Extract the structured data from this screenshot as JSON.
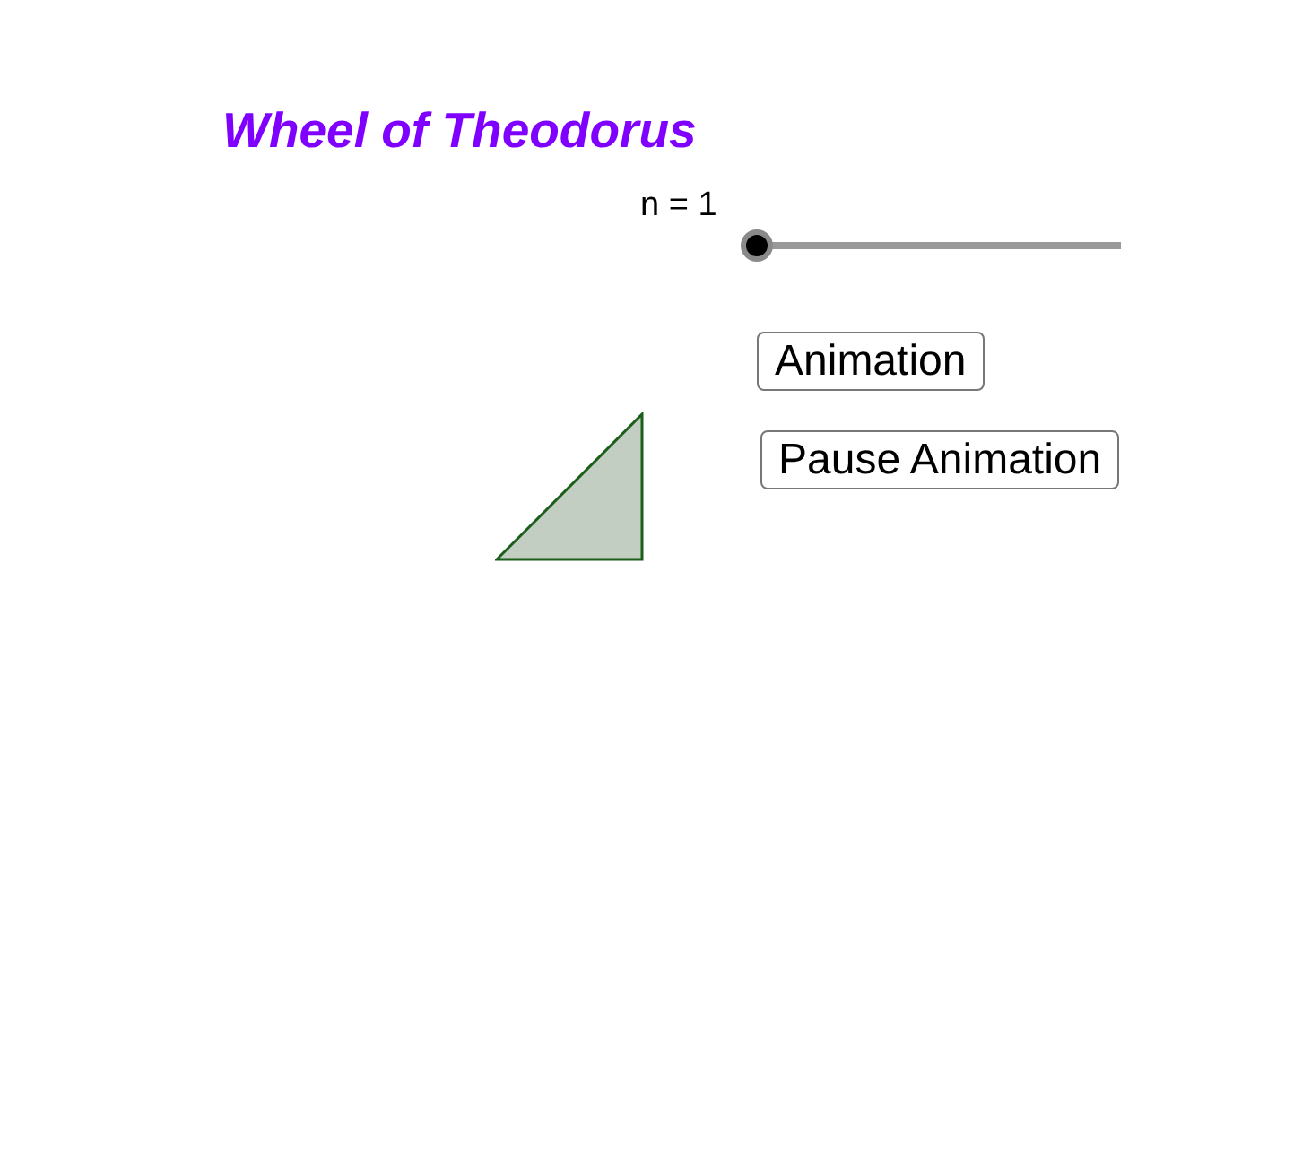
{
  "title": "Wheel of Theodorus",
  "slider": {
    "label": "n = 1",
    "level": 0
  },
  "buttons": [
    {
      "label": "Animation"
    },
    {
      "label": "Pause Animation"
    }
  ]
}
